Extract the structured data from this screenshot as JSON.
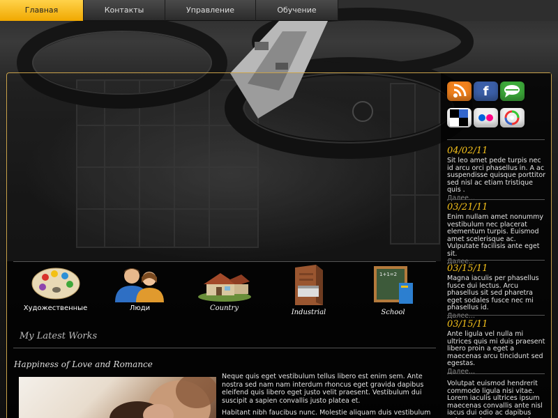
{
  "nav": {
    "items": [
      {
        "label": "Главная",
        "active": true
      },
      {
        "label": "Контакты",
        "active": false
      },
      {
        "label": "Управление",
        "active": false
      },
      {
        "label": "Обучение",
        "active": false
      }
    ]
  },
  "categories": [
    {
      "label": "Художественные",
      "icon": "palette-icon"
    },
    {
      "label": "Люди",
      "icon": "people-icon"
    },
    {
      "label": "Country",
      "icon": "house-icon"
    },
    {
      "label": "Industrial",
      "icon": "building-icon"
    },
    {
      "label": "School",
      "icon": "chalkboard-icon"
    }
  ],
  "latest": {
    "heading": "My Latest Works"
  },
  "post": {
    "title": "Happiness of Love and Romance",
    "paragraphs": [
      "Neque quis eget vestibulum tellus libero est enim sem. Ante nostra sed nam nam interdum rhoncus eget gravida dapibus eleifend quis libero eget justo velit praesent. Vestibulum dui suscipit a sapien convallis justo platea et.",
      "Habitant nibh faucibus nunc. Molestie aliquam duis vestibulum"
    ]
  },
  "social": [
    {
      "name": "rss-icon",
      "color": "#f2821e"
    },
    {
      "name": "facebook-icon",
      "color": "#3b5fa8"
    },
    {
      "name": "chat-icon",
      "color": "#3daa3a"
    },
    {
      "name": "delicious-icon",
      "color": "#ffffff"
    },
    {
      "name": "flickr-icon",
      "color": "#f0f0f0"
    },
    {
      "name": "picasa-icon",
      "color": "#f0f0f0"
    }
  ],
  "news": [
    {
      "date": "04/02/11",
      "text": "Sit leo amet pede turpis nec id arcu orci phasellus in. A ac suspendisse quisque porttitor sed nisl ac etiam tristique quis .",
      "more": "Далее..."
    },
    {
      "date": "03/21/11",
      "text": "Enim nullam amet nonummy vestibulum nec placerat elementum turpis. Euismod amet scelerisque ac. Vulputate facilisis ante eget sit.",
      "more": "Далее..."
    },
    {
      "date": "03/15/11",
      "text": "Magna iaculis per phasellus fusce dui lectus. Arcu phasellus sit sed pharetra eget sodales fusce nec mi phasellus id.",
      "more": "Далее..."
    },
    {
      "date": "03/15/11",
      "text": "Ante ligula vel nulla mi ultrices quis mi duis praesent libero proin a eget a maecenas arcu tincidunt sed egestas.",
      "more": "Далее..."
    }
  ],
  "sidebar_bottom": "Volutpat euismod hendrerit commodo ligula nisi vitae. Lorem iaculis ultrices ipsum maecenas convallis ante nisl iacus dui odio ac dapibus ante egestas maecenas leo.",
  "colors": {
    "accent": "#f6c21a",
    "frame_border": "#c9a24a",
    "nav_active": "#f0a800"
  }
}
